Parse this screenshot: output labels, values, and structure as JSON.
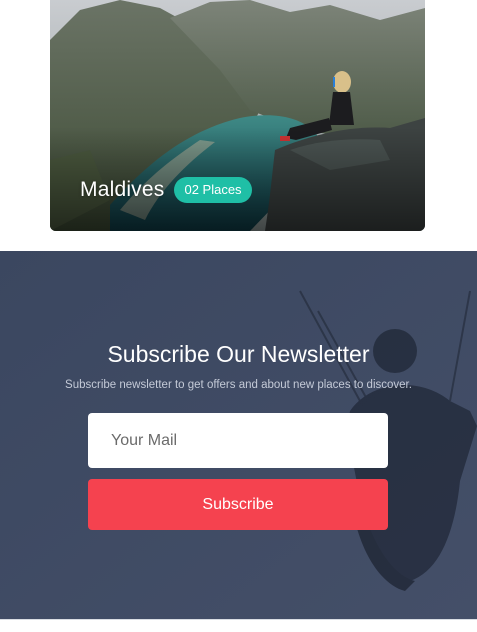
{
  "destination_card": {
    "title": "Maldives",
    "badge": "02 Places"
  },
  "newsletter": {
    "title": "Subscribe Our Newsletter",
    "subtitle": "Subscribe newsletter to get offers and about new places to discover.",
    "email_placeholder": "Your Mail",
    "email_value": "",
    "subscribe_label": "Subscribe"
  },
  "colors": {
    "badge": "#1fbfa6",
    "subscribe_button": "#f5424f",
    "newsletter_bg": "#3e4a63"
  }
}
